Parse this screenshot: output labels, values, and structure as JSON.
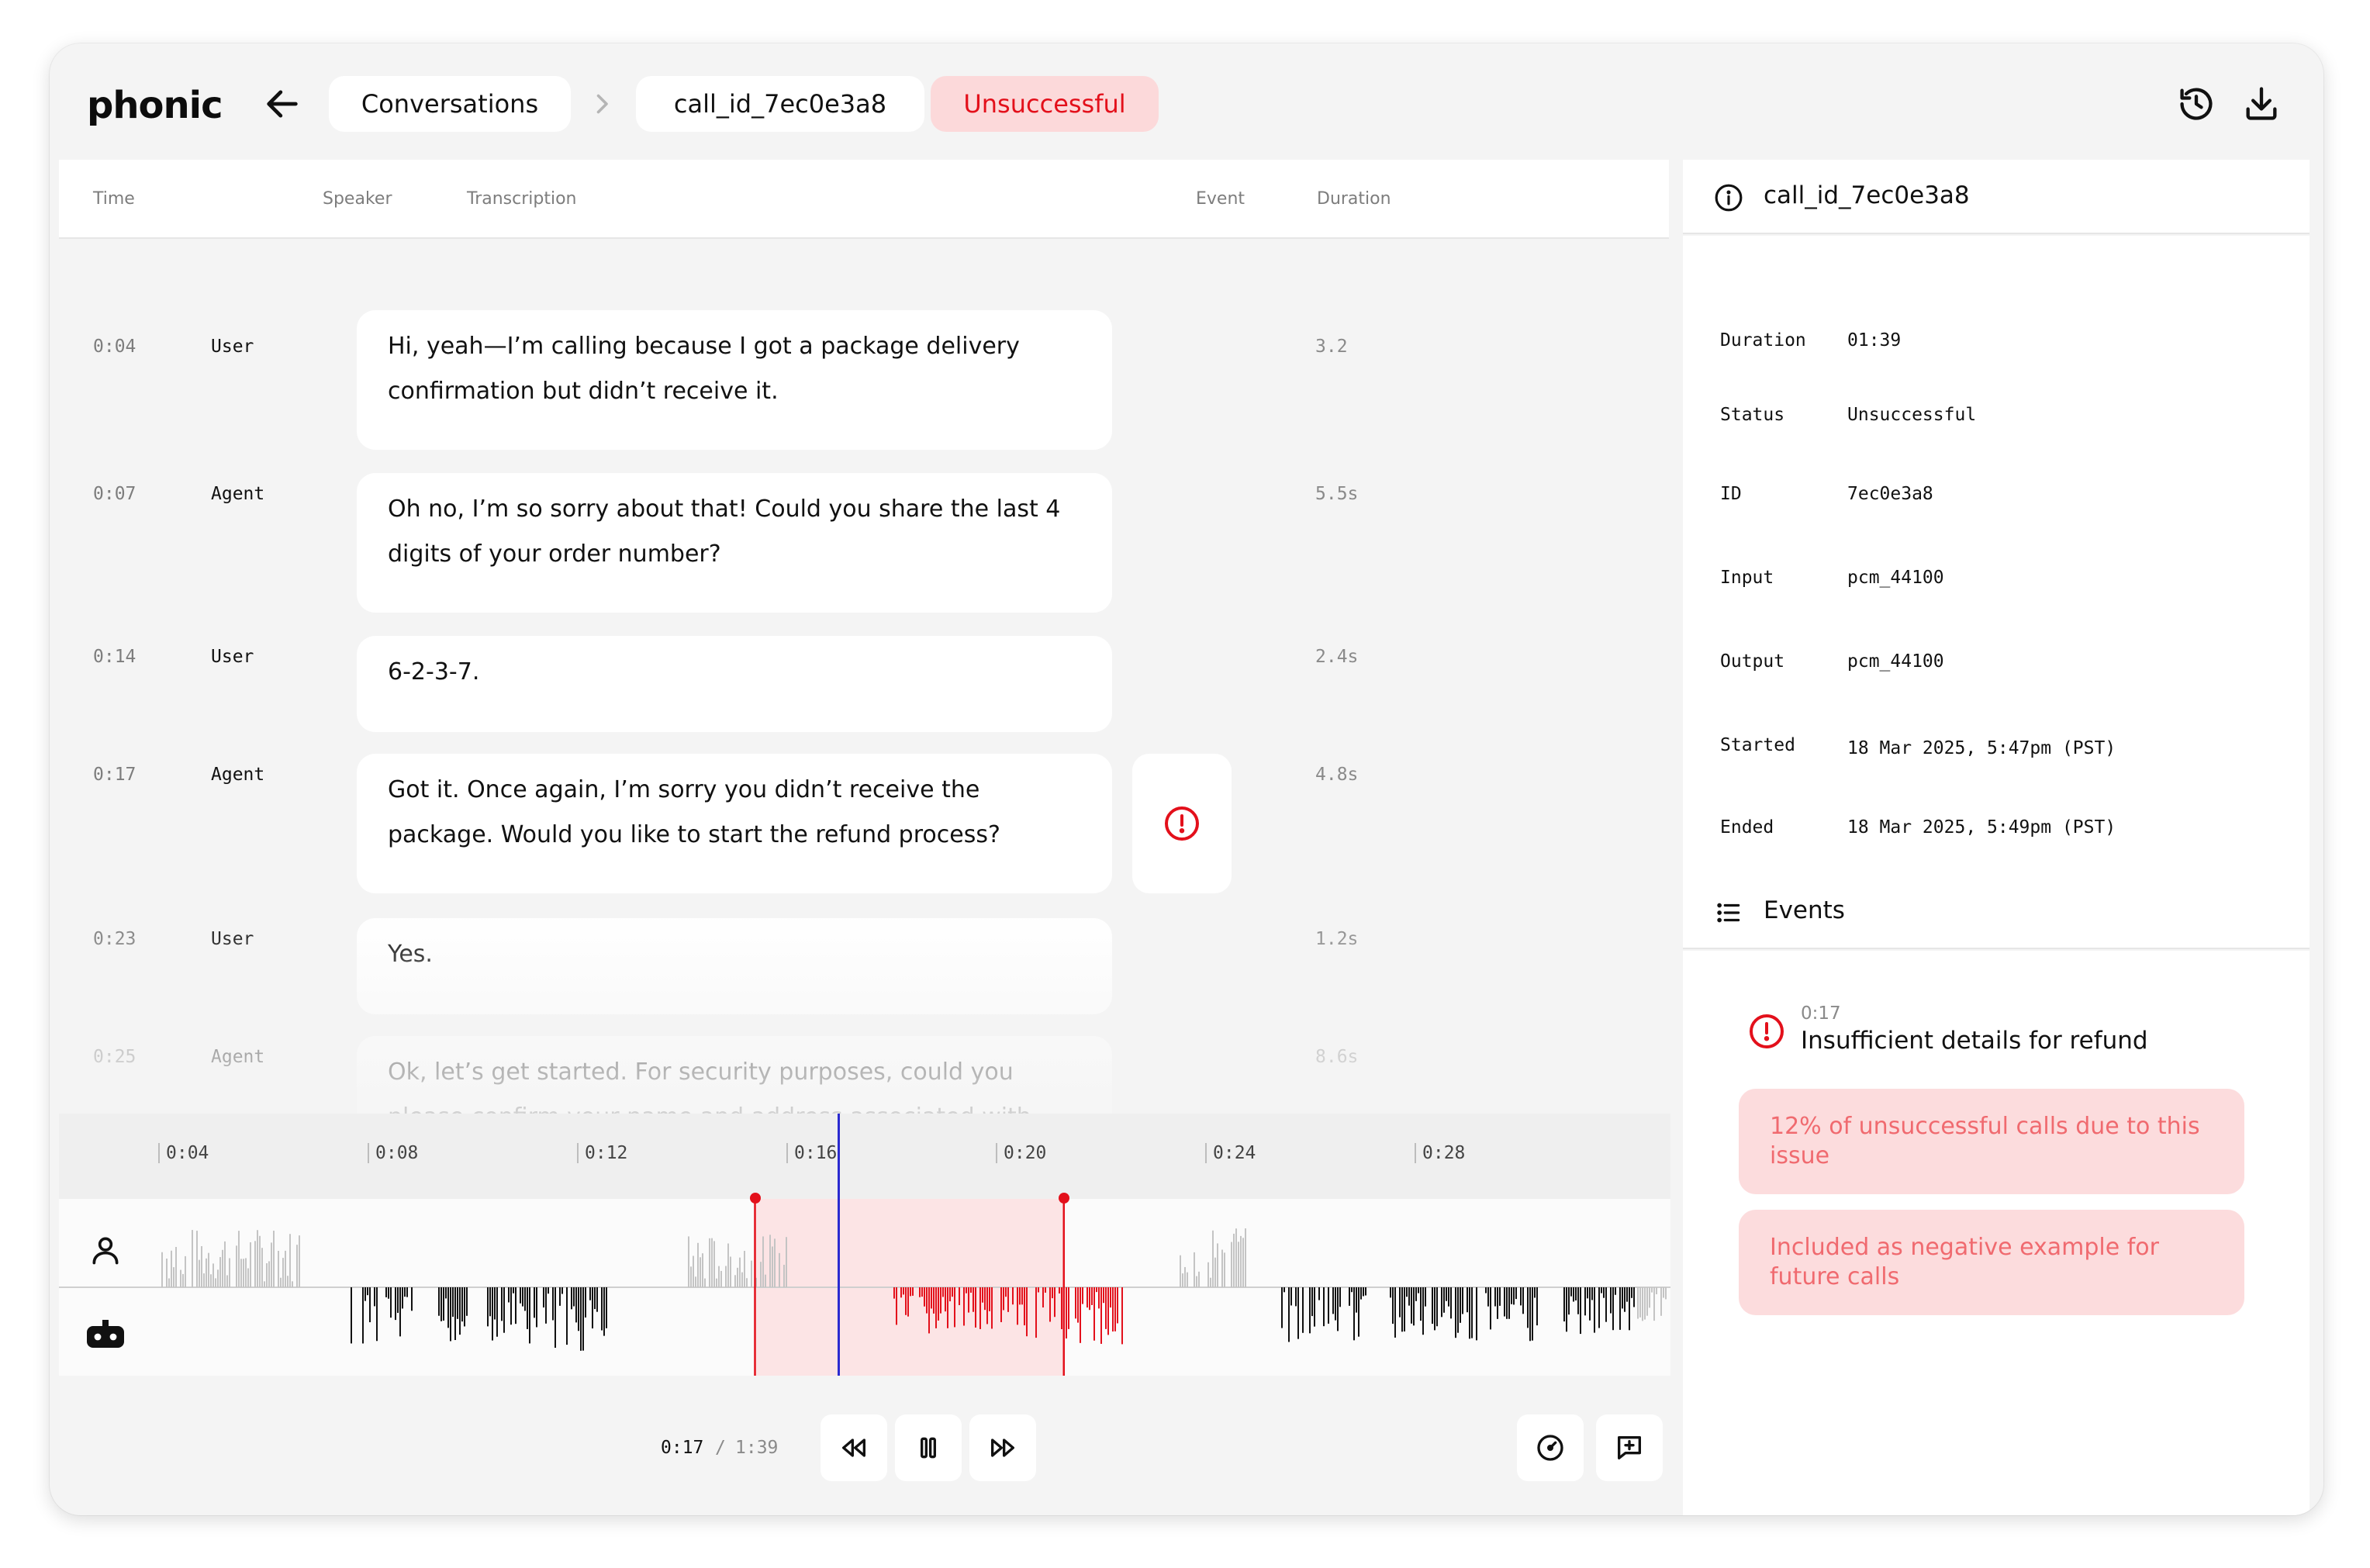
{
  "header": {
    "logo": "phonic",
    "breadcrumb": {
      "conversations": "Conversations",
      "call_id": "call_id_7ec0e3a8"
    },
    "status_badge": "Unsuccessful"
  },
  "transcript": {
    "columns": {
      "time": "Time",
      "speaker": "Speaker",
      "transcription": "Transcription",
      "event": "Event",
      "duration": "Duration"
    },
    "rows": [
      {
        "time": "0:04",
        "speaker": "User",
        "text_lines": [
          "Hi, yeah—I’m calling because I got a package delivery",
          "confirmation but didn’t receive it."
        ],
        "duration": "3.2",
        "has_event": false
      },
      {
        "time": "0:07",
        "speaker": "Agent",
        "text_lines": [
          "Oh no, I’m so sorry about that! Could you share the last 4",
          "digits of your order number?"
        ],
        "duration": "5.5s",
        "has_event": false
      },
      {
        "time": "0:14",
        "speaker": "User",
        "text_lines": [
          "6-2-3-7."
        ],
        "duration": "2.4s",
        "has_event": false
      },
      {
        "time": "0:17",
        "speaker": "Agent",
        "text_lines": [
          "Got it. Once again, I’m sorry you didn’t receive the",
          "package. Would you like to start the refund process?"
        ],
        "duration": "4.8s",
        "has_event": true
      },
      {
        "time": "0:23",
        "speaker": "User",
        "text_lines": [
          "Yes."
        ],
        "duration": "1.2s",
        "has_event": false
      },
      {
        "time": "0:25",
        "speaker": "Agent",
        "text_lines": [
          "Ok, let’s get started. For security purposes, could you",
          "please confirm your name and address associated with"
        ],
        "duration": "8.6s",
        "has_event": false
      }
    ]
  },
  "timeline": {
    "ticks": [
      "0:04",
      "0:08",
      "0:12",
      "0:16",
      "0:20",
      "0:24",
      "0:28"
    ],
    "playhead_seconds": 17,
    "event_range_seconds": [
      15.4,
      21.3
    ]
  },
  "player": {
    "current": "0:17",
    "separator": "/",
    "total": "1:39"
  },
  "details": {
    "title": "call_id_7ec0e3a8",
    "fields": [
      {
        "key": "Duration",
        "value": "01:39"
      },
      {
        "key": "Status",
        "value": "Unsuccessful"
      },
      {
        "key": "ID",
        "value": "7ec0e3a8"
      },
      {
        "key": "Input",
        "value": "pcm_44100"
      },
      {
        "key": "Output",
        "value": "pcm_44100"
      },
      {
        "key": "Started",
        "value": "18 Mar 2025, 5:47pm (PST)"
      },
      {
        "key": "Ended",
        "value": "18 Mar 2025, 5:49pm (PST)"
      }
    ]
  },
  "events": {
    "title": "Events",
    "items": [
      {
        "time": "0:17",
        "title": "Insufficient details for refund",
        "notes": [
          "12% of unsuccessful calls due to this issue",
          "Included as negative example for future calls"
        ]
      }
    ]
  },
  "colors": {
    "accent_red": "#e3101b",
    "badge_bg": "#fcd9da",
    "pill_text": "#f06a6f",
    "playhead": "#2a2ad0"
  },
  "icons": [
    "arrow-left-icon",
    "chevron-right-icon",
    "history-icon",
    "download-icon",
    "alert-circle-icon",
    "info-icon",
    "list-icon",
    "user-icon",
    "bot-icon",
    "rewind-icon",
    "pause-icon",
    "fast-forward-icon",
    "speed-icon",
    "add-comment-icon"
  ]
}
